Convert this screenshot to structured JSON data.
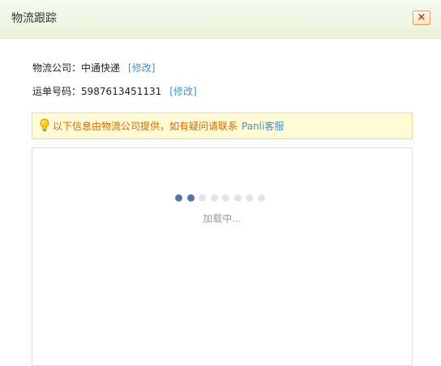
{
  "dialog": {
    "title": "物流跟踪",
    "close_label": "×"
  },
  "info": {
    "company_label": "物流公司：",
    "company_value": "中通快递",
    "company_edit": "[修改]",
    "waybill_label": "运单号码：",
    "waybill_value": "5987613451131",
    "waybill_edit": "[修改]"
  },
  "notice": {
    "text": "以下信息由物流公司提供，如有疑问请联系",
    "link": "Panli客服",
    "icon": "lightbulb-icon"
  },
  "tracking": {
    "loading_text": "加载中...",
    "loader_dots_total": 8,
    "loader_dots_active": 2
  },
  "colors": {
    "header_bg": "#eaf3dc",
    "notice_bg": "#fffbd6",
    "notice_text": "#d06a00",
    "link": "#4a8fc7",
    "dot_active": "#5b74a8",
    "dot_inactive": "#dfe3ec",
    "close_x": "#c0392b"
  }
}
